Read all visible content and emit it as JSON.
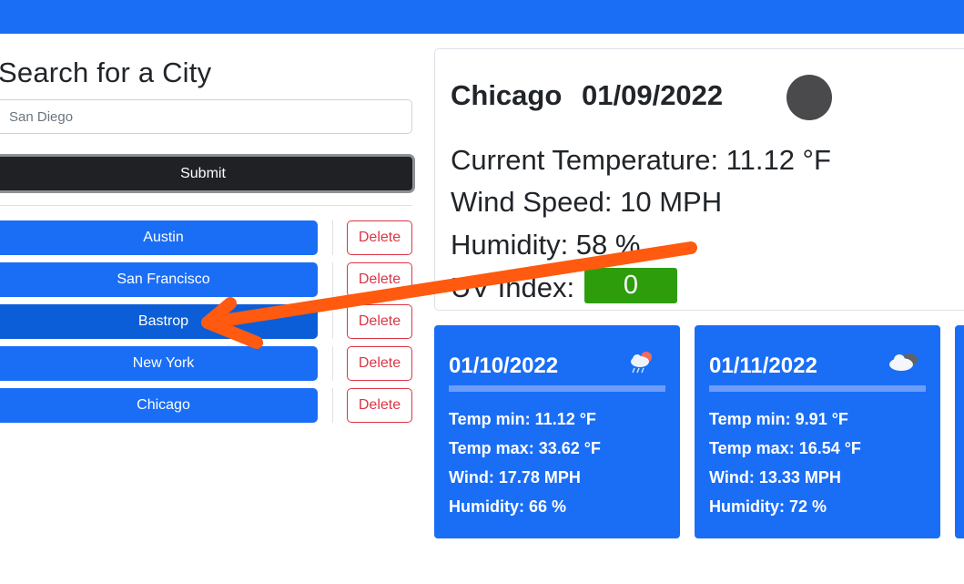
{
  "search": {
    "title": "Search for a City",
    "input_value": "San Diego",
    "submit_label": "Submit"
  },
  "history": [
    {
      "city": "Austin",
      "delete_label": "Delete"
    },
    {
      "city": "San Francisco",
      "delete_label": "Delete"
    },
    {
      "city": "Bastrop",
      "delete_label": "Delete"
    },
    {
      "city": "New York",
      "delete_label": "Delete"
    },
    {
      "city": "Chicago",
      "delete_label": "Delete"
    }
  ],
  "current": {
    "city": "Chicago",
    "date": "01/09/2022",
    "icon": "weather-icon",
    "temperature_label": "Current Temperature: 11.12 °F",
    "wind_label": "Wind Speed: 10 MPH",
    "humidity_label": "Humidity: 58 %",
    "uv_label": "UV Index:",
    "uv_value": "0",
    "uv_color": "#2e9d0c"
  },
  "forecast": [
    {
      "date": "01/10/2022",
      "icon": "rain-sun-cloud-icon",
      "temp_min": "Temp min: 11.12 °F",
      "temp_max": "Temp max: 33.62 °F",
      "wind": "Wind: 17.78 MPH",
      "humidity": "Humidity: 66 %"
    },
    {
      "date": "01/11/2022",
      "icon": "cloud-icon",
      "temp_min": "Temp min: 9.91 °F",
      "temp_max": "Temp max: 16.54 °F",
      "wind": "Wind: 13.33 MPH",
      "humidity": "Humidity: 72 %"
    }
  ],
  "colors": {
    "accent": "#1a6ef5",
    "danger": "#dc3545",
    "dark_button": "#1f2124",
    "annotation_arrow": "#ff5a0f"
  }
}
